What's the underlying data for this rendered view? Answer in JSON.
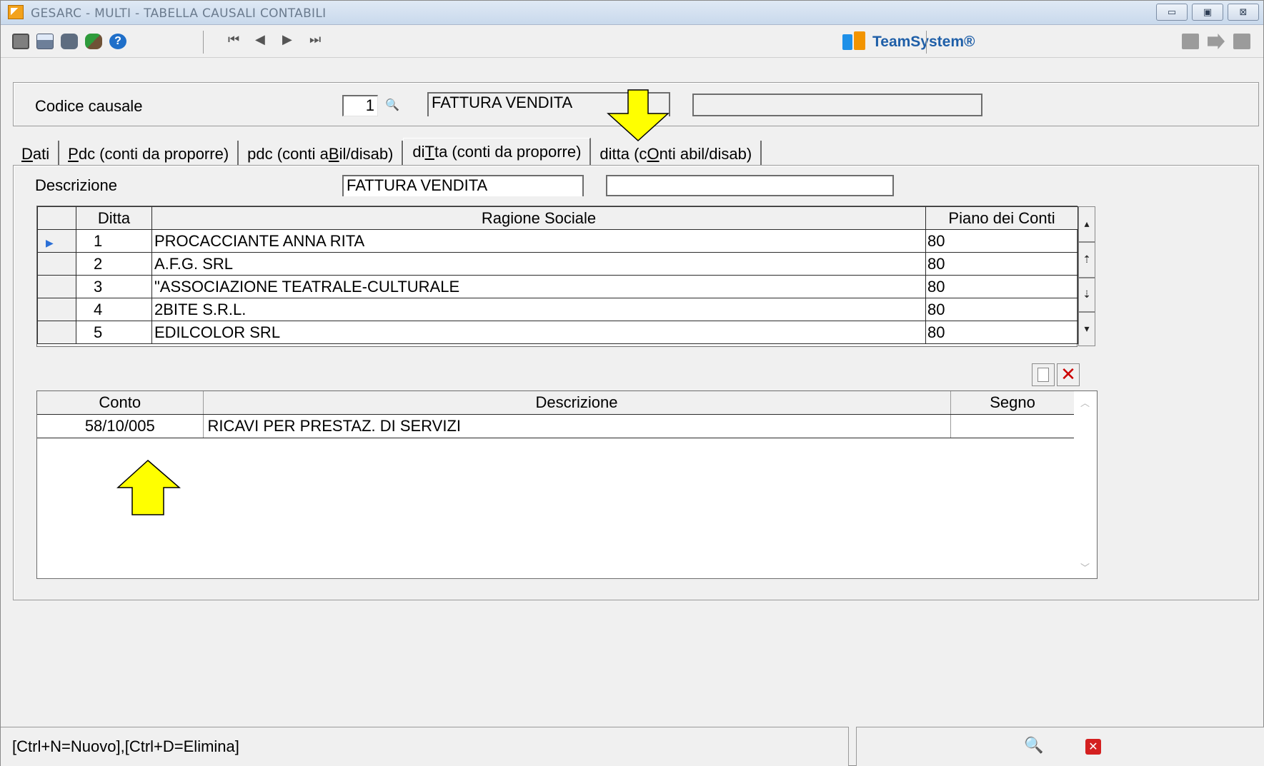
{
  "window": {
    "title": "GESARC  - MULTI -  TABELLA CAUSALI CONTABILI",
    "minimize_label": "▭",
    "maximize_label": "▣",
    "close_label": "⊠"
  },
  "toolbar": {
    "brand": "TeamSystem®",
    "nav_first": "⏮",
    "nav_prev": "◀",
    "nav_next": "▶",
    "nav_last": "⏭"
  },
  "header": {
    "codice_label": "Codice causale",
    "codice_value": "1",
    "descrizione_value": "FATTURA VENDITA",
    "extra_value": ""
  },
  "tabs": [
    {
      "pre": "",
      "u": "D",
      "post": "ati",
      "active": false
    },
    {
      "pre": "",
      "u": "P",
      "post": "dc (conti da proporre)",
      "active": false
    },
    {
      "pre": "pdc (conti a",
      "u": "B",
      "post": "il/disab)",
      "active": false
    },
    {
      "pre": "di",
      "u": "T",
      "post": "ta (conti da proporre)",
      "active": true
    },
    {
      "pre": "ditta (c",
      "u": "O",
      "post": "nti abil/disab)",
      "active": false
    }
  ],
  "panel": {
    "descrizione_label": "Descrizione",
    "descrizione_value": "FATTURA VENDITA",
    "descrizione_extra": ""
  },
  "ditta_grid": {
    "columns": [
      "Ditta",
      "Ragione Sociale",
      "Piano dei Conti"
    ],
    "rows": [
      {
        "ditta": "1",
        "ragione": "PROCACCIANTE ANNA RITA",
        "piano": "80",
        "selected": true
      },
      {
        "ditta": "2",
        "ragione": "A.F.G. SRL",
        "piano": "80",
        "selected": false
      },
      {
        "ditta": "3",
        "ragione": "\"ASSOCIAZIONE TEATRALE-CULTURALE",
        "piano": "80",
        "selected": false
      },
      {
        "ditta": "4",
        "ragione": "2BITE S.R.L.",
        "piano": "80",
        "selected": false
      },
      {
        "ditta": "5",
        "ragione": "EDILCOLOR SRL",
        "piano": "80",
        "selected": false
      }
    ]
  },
  "conti_grid": {
    "columns": [
      "Conto",
      "Descrizione",
      "Segno"
    ],
    "rows": [
      {
        "conto": "58/10/005",
        "descrizione": "RICAVI PER PRESTAZ. DI SERVIZI",
        "segno": ""
      }
    ]
  },
  "status": {
    "shortcuts": "[Ctrl+N=Nuovo],[Ctrl+D=Elimina]"
  },
  "colors": {
    "highlight_arrow": "#ffff00",
    "brand_blue": "#1f5fa8",
    "brand_orange": "#f29400"
  }
}
